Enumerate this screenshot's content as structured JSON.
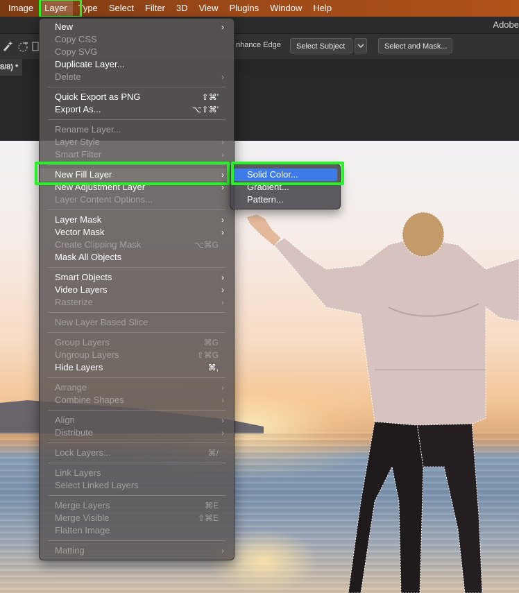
{
  "menubar": {
    "items": [
      "Image",
      "Layer",
      "Type",
      "Select",
      "Filter",
      "3D",
      "View",
      "Plugins",
      "Window",
      "Help"
    ],
    "active": "Layer"
  },
  "titlebar": {
    "app_title": "Adobe"
  },
  "options_bar": {
    "enhance_edge_label": "nhance Edge",
    "select_subject_label": "Select Subject",
    "select_and_mask_label": "Select and Mask..."
  },
  "document": {
    "tab_label": "8/8) *"
  },
  "layer_menu": {
    "groups": [
      [
        {
          "label": "New",
          "enabled": true,
          "submenu": true
        },
        {
          "label": "Copy CSS",
          "enabled": false
        },
        {
          "label": "Copy SVG",
          "enabled": false
        },
        {
          "label": "Duplicate Layer...",
          "enabled": true
        },
        {
          "label": "Delete",
          "enabled": false,
          "submenu": true
        }
      ],
      [
        {
          "label": "Quick Export as PNG",
          "enabled": true,
          "shortcut": "⇧⌘'"
        },
        {
          "label": "Export As...",
          "enabled": true,
          "shortcut": "⌥⇧⌘'"
        }
      ],
      [
        {
          "label": "Rename Layer...",
          "enabled": false
        },
        {
          "label": "Layer Style",
          "enabled": false,
          "submenu": true
        },
        {
          "label": "Smart Filter",
          "enabled": false,
          "submenu": true
        }
      ],
      [
        {
          "label": "New Fill Layer",
          "enabled": true,
          "submenu": true,
          "selected": true
        },
        {
          "label": "New Adjustment Layer",
          "enabled": true,
          "submenu": true
        },
        {
          "label": "Layer Content Options...",
          "enabled": false
        }
      ],
      [
        {
          "label": "Layer Mask",
          "enabled": true,
          "submenu": true
        },
        {
          "label": "Vector Mask",
          "enabled": true,
          "submenu": true
        },
        {
          "label": "Create Clipping Mask",
          "enabled": false,
          "shortcut": "⌥⌘G"
        },
        {
          "label": "Mask All Objects",
          "enabled": true
        }
      ],
      [
        {
          "label": "Smart Objects",
          "enabled": true,
          "submenu": true
        },
        {
          "label": "Video Layers",
          "enabled": true,
          "submenu": true
        },
        {
          "label": "Rasterize",
          "enabled": false,
          "submenu": true
        }
      ],
      [
        {
          "label": "New Layer Based Slice",
          "enabled": false
        }
      ],
      [
        {
          "label": "Group Layers",
          "enabled": false,
          "shortcut": "⌘G"
        },
        {
          "label": "Ungroup Layers",
          "enabled": false,
          "shortcut": "⇧⌘G"
        },
        {
          "label": "Hide Layers",
          "enabled": true,
          "shortcut": "⌘,"
        }
      ],
      [
        {
          "label": "Arrange",
          "enabled": false,
          "submenu": true
        },
        {
          "label": "Combine Shapes",
          "enabled": false,
          "submenu": true
        }
      ],
      [
        {
          "label": "Align",
          "enabled": false,
          "submenu": true
        },
        {
          "label": "Distribute",
          "enabled": false,
          "submenu": true
        }
      ],
      [
        {
          "label": "Lock Layers...",
          "enabled": false,
          "shortcut": "⌘/"
        }
      ],
      [
        {
          "label": "Link Layers",
          "enabled": false
        },
        {
          "label": "Select Linked Layers",
          "enabled": false
        }
      ],
      [
        {
          "label": "Merge Layers",
          "enabled": false,
          "shortcut": "⌘E"
        },
        {
          "label": "Merge Visible",
          "enabled": false,
          "shortcut": "⇧⌘E"
        },
        {
          "label": "Flatten Image",
          "enabled": false
        }
      ],
      [
        {
          "label": "Matting",
          "enabled": false,
          "submenu": true
        }
      ]
    ]
  },
  "fill_submenu": {
    "items": [
      {
        "label": "Solid Color...",
        "selected": true
      },
      {
        "label": "Gradient..."
      },
      {
        "label": "Pattern..."
      }
    ]
  },
  "colors": {
    "highlight_annotation": "#27f227",
    "submenu_selection": "#3d7be8",
    "menubar_bg": "#9a4818"
  },
  "icons": [
    "brush-plus-icon",
    "brush-minus-icon",
    "dropdown-chevron-icon",
    "submenu-arrow-icon"
  ]
}
